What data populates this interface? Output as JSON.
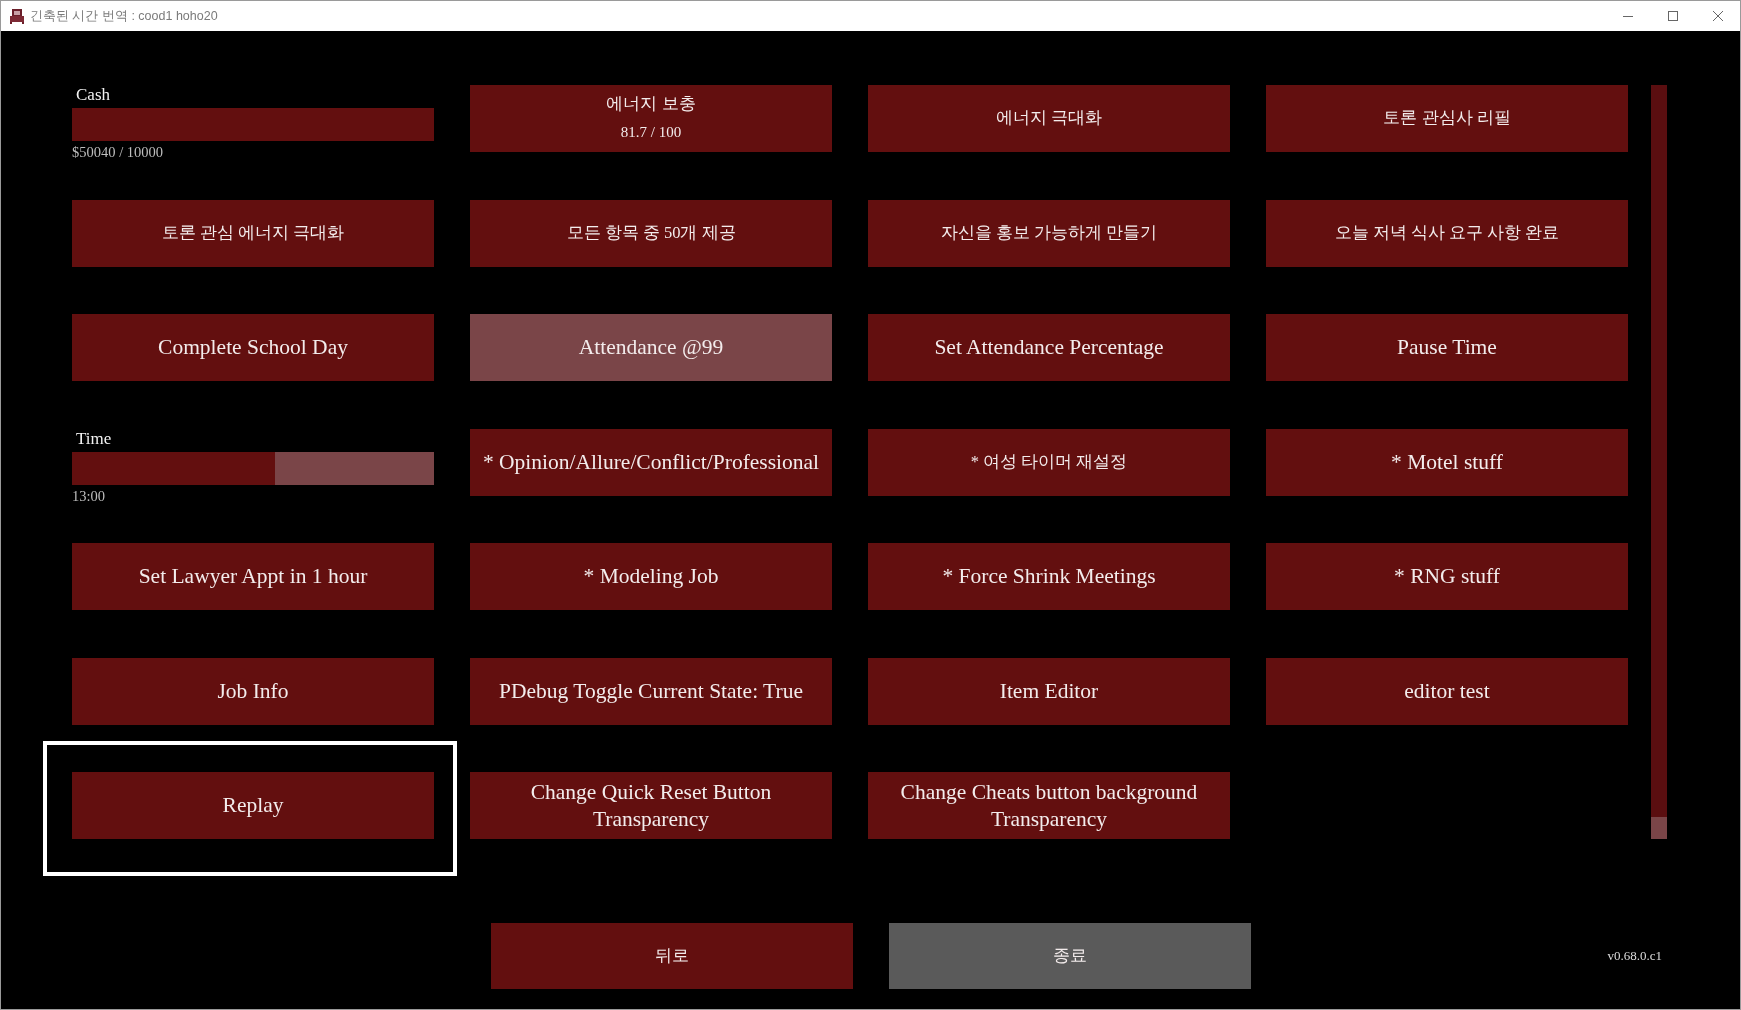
{
  "window": {
    "title": "긴축된 시간 번역 : cood1 hoho20"
  },
  "grid": [
    {
      "kind": "stat",
      "label": "Cash",
      "level": 1,
      "value": "$50040 / 10000"
    },
    {
      "kind": "button",
      "label": "에너지 보충",
      "detail": "81.7 / 100",
      "highlighted": false,
      "focused": false
    },
    {
      "kind": "button",
      "label": "에너지 극대화",
      "highlighted": false,
      "focused": false
    },
    {
      "kind": "button",
      "label": "토론 관심사 리필",
      "highlighted": false,
      "focused": false
    },
    {
      "kind": "button",
      "label": "토론 관심 에너지 극대화",
      "highlighted": false,
      "focused": false
    },
    {
      "kind": "button",
      "label": "모든 항목 중 50개 제공",
      "highlighted": false,
      "focused": false
    },
    {
      "kind": "button",
      "label": "자신을 홍보 가능하게 만들기",
      "highlighted": false,
      "focused": false
    },
    {
      "kind": "button",
      "label": "오늘 저녁 식사 요구 사항 완료",
      "highlighted": false,
      "focused": false
    },
    {
      "kind": "button",
      "label": "Complete School Day",
      "highlighted": false,
      "focused": false
    },
    {
      "kind": "button",
      "label": "Attendance @99",
      "highlighted": true,
      "focused": false
    },
    {
      "kind": "button",
      "label": "Set Attendance Percentage",
      "highlighted": false,
      "focused": false
    },
    {
      "kind": "button",
      "label": "Pause Time",
      "highlighted": false,
      "focused": false
    },
    {
      "kind": "stat",
      "label": "Time",
      "level": 0.56,
      "value": "13:00"
    },
    {
      "kind": "button",
      "label": "* Opinion/Allure/Conflict/Professional",
      "highlighted": false,
      "focused": false
    },
    {
      "kind": "button",
      "label": "* 여성 타이머 재설정",
      "highlighted": false,
      "focused": false
    },
    {
      "kind": "button",
      "label": "* Motel stuff",
      "highlighted": false,
      "focused": false
    },
    {
      "kind": "button",
      "label": "Set Lawyer Appt in 1 hour",
      "highlighted": false,
      "focused": false
    },
    {
      "kind": "button",
      "label": "* Modeling Job",
      "highlighted": false,
      "focused": false
    },
    {
      "kind": "button",
      "label": "* Force Shrink Meetings",
      "highlighted": false,
      "focused": false
    },
    {
      "kind": "button",
      "label": "* RNG stuff",
      "highlighted": false,
      "focused": false
    },
    {
      "kind": "button",
      "label": "Job Info",
      "highlighted": false,
      "focused": false
    },
    {
      "kind": "button",
      "label": "PDebug Toggle Current State: True",
      "highlighted": false,
      "focused": false
    },
    {
      "kind": "button",
      "label": "Item Editor",
      "highlighted": false,
      "focused": false
    },
    {
      "kind": "button",
      "label": "editor test",
      "highlighted": false,
      "focused": false
    },
    {
      "kind": "button",
      "label": "Replay",
      "highlighted": false,
      "focused": true
    },
    {
      "kind": "button",
      "label": "Change Quick Reset Button Transparency",
      "highlighted": false,
      "focused": false
    },
    {
      "kind": "button",
      "label": "Change Cheats button background Transparency",
      "highlighted": false,
      "focused": false
    }
  ],
  "bottom_buttons": [
    {
      "label": "뒤로",
      "color": "#630f0f"
    },
    {
      "label": "종료",
      "color": "#5a5a5a"
    }
  ],
  "version": "v0.68.0.c1"
}
